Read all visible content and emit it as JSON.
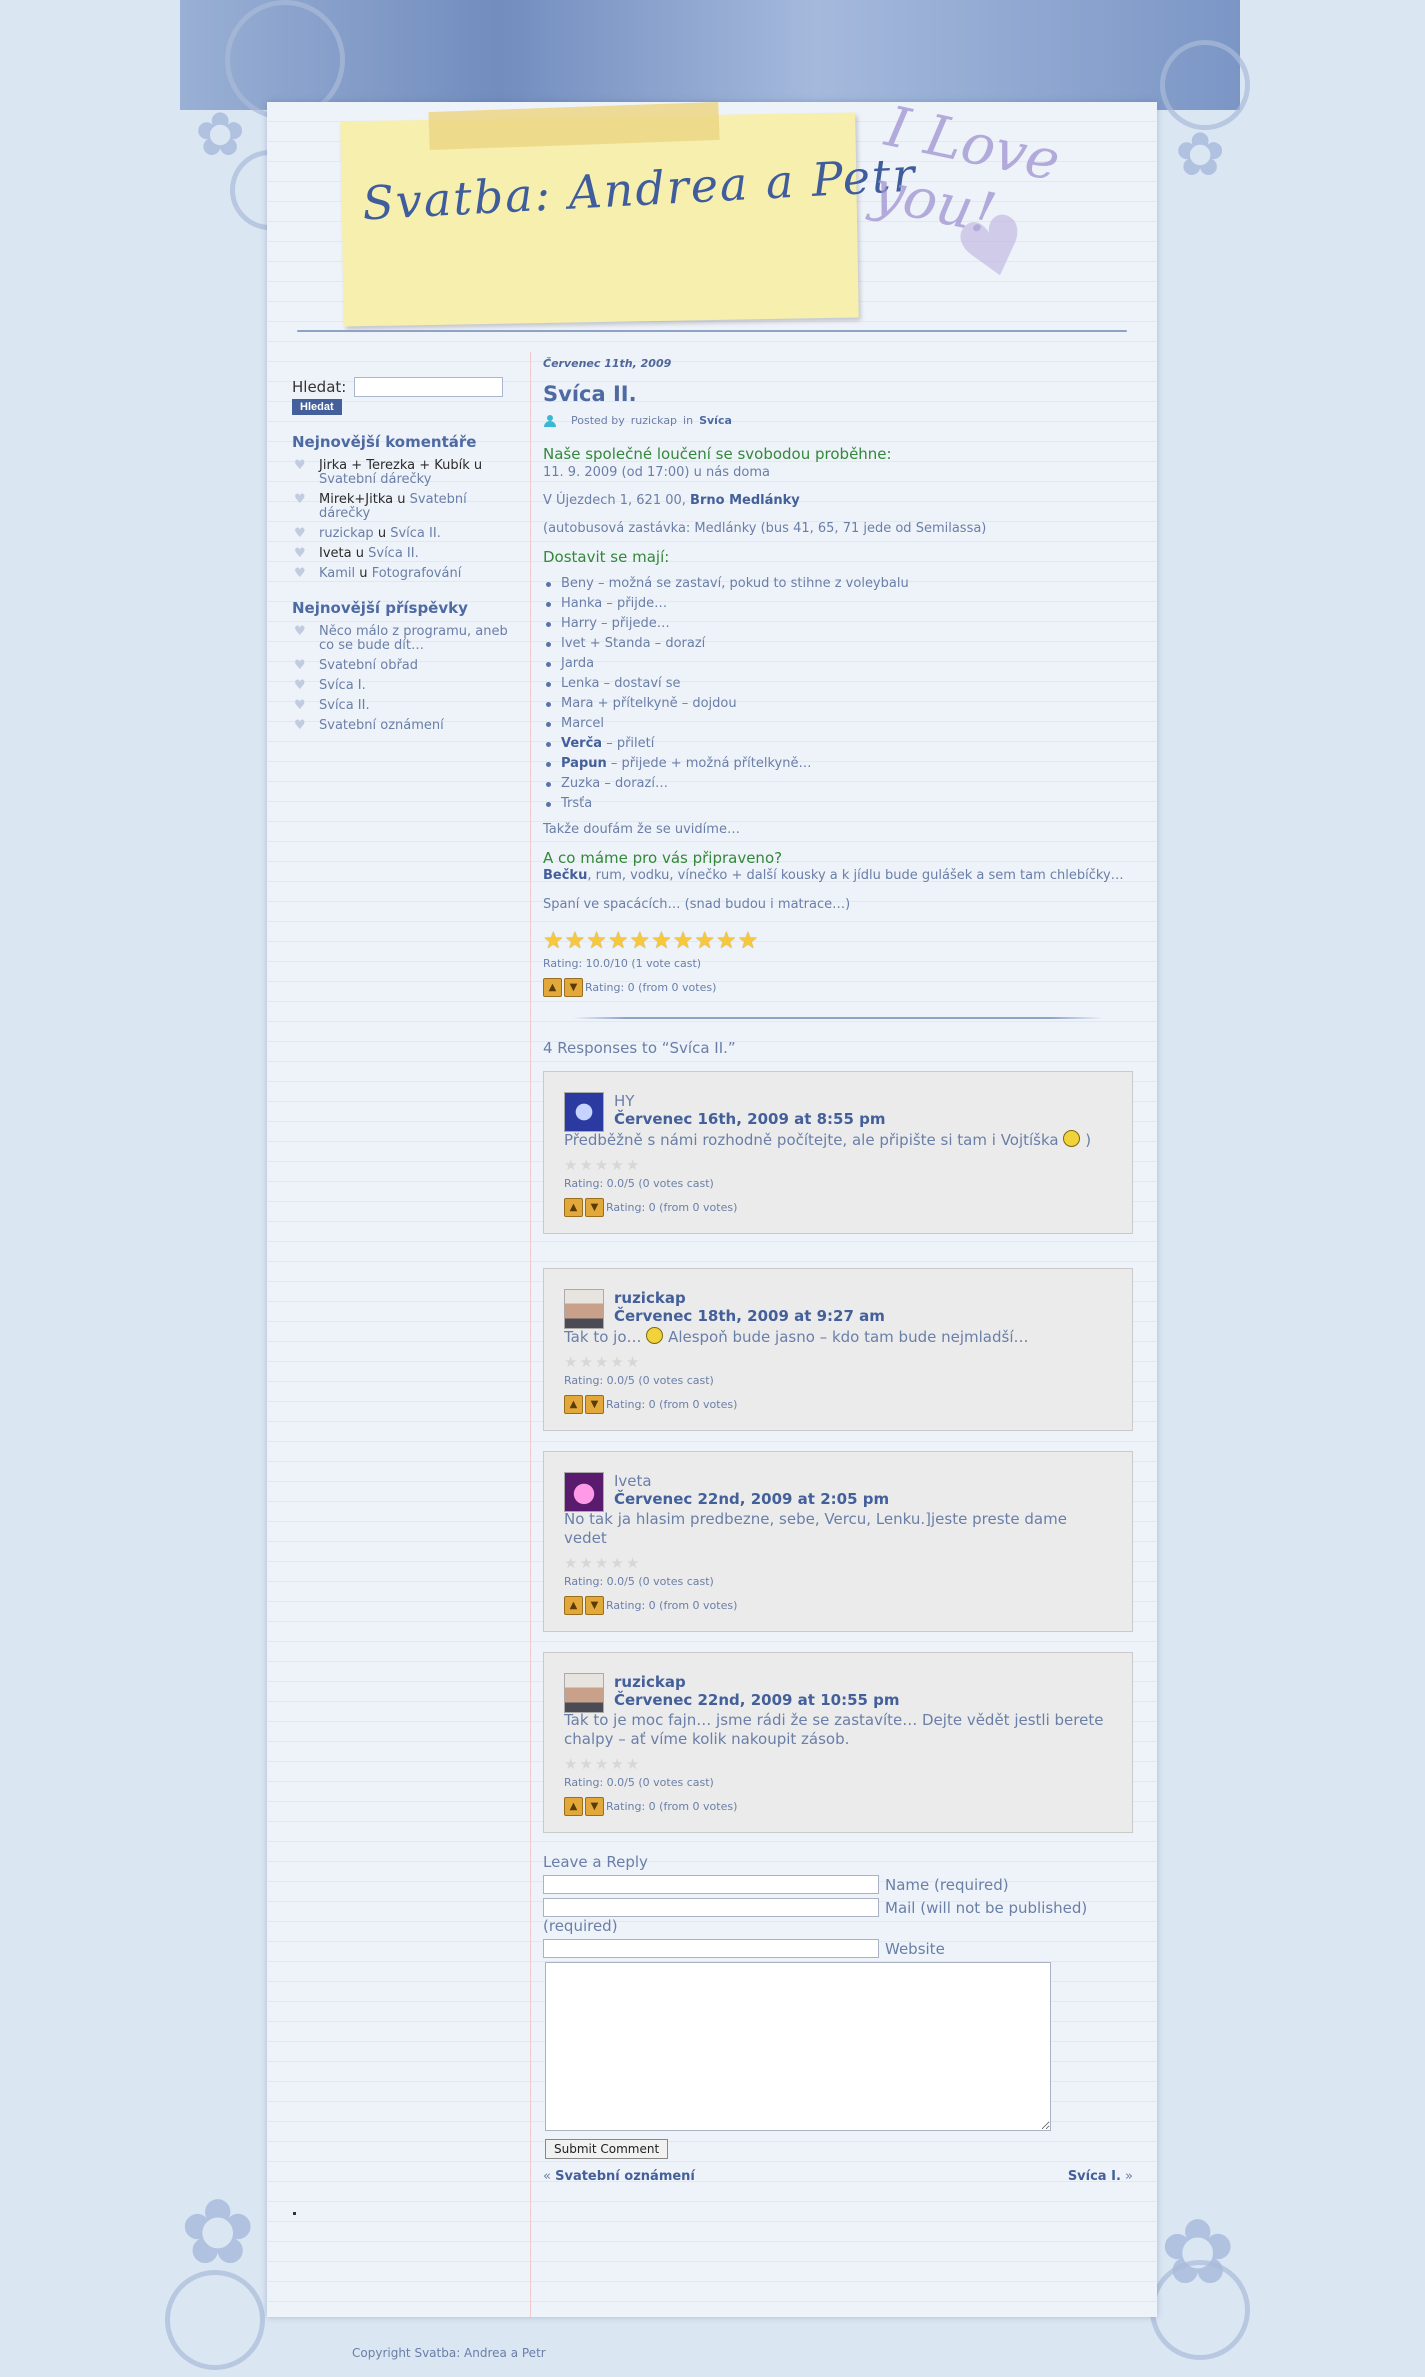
{
  "header": {
    "site_title": "Svatba: Andrea a Petr",
    "decor_text": "I Love you!"
  },
  "sidebar": {
    "search": {
      "label": "Hledat:",
      "button": "Hledat"
    },
    "recent_comments_title": "Nejnovější komentáře",
    "recent_comments": [
      {
        "author": "Jirka + Terezka + Kubík",
        "sep": "u",
        "post": "Svatební dárečky"
      },
      {
        "author": "Mirek+Jitka",
        "sep": "u",
        "post": "Svatební dárečky"
      },
      {
        "author": "ruzickap",
        "sep": "u",
        "post": "Svíca II."
      },
      {
        "author": "Iveta",
        "sep": "u",
        "post": "Svíca II."
      },
      {
        "author": "Kamil",
        "sep": "u",
        "post": "Fotografování"
      }
    ],
    "recent_posts_title": "Nejnovější příspěvky",
    "recent_posts": [
      "Něco málo z programu, aneb co se bude dít…",
      "Svatební obřad",
      "Svíca I.",
      "Svíca II.",
      "Svatební oznámení"
    ]
  },
  "post": {
    "date": "Červenec 11th, 2009",
    "title": "Svíca II.",
    "meta_prefix": "Posted by",
    "meta_author": "ruzickap",
    "meta_in": "in",
    "meta_category": "Svíca",
    "heading1": "Naše společné loučení se svobodou proběhne:",
    "line_date": "11. 9. 2009 (od 17:00) u nás doma",
    "line_addr_prefix": "V Újezdech 1, 621 00,",
    "line_addr_bold": "Brno Medlánky",
    "line_bus": "(autobusová zastávka: Medlánky (bus 41, 65, 71 jede od Semilassa)",
    "heading2": "Dostavit se mají:",
    "guests": [
      {
        "bold": "",
        "text": "Beny – možná se zastaví, pokud to stihne z voleybalu"
      },
      {
        "bold": "",
        "text": "Hanka – přijde…"
      },
      {
        "bold": "",
        "text": "Harry – přijede…"
      },
      {
        "bold": "",
        "text": "Ivet + Standa – dorazí"
      },
      {
        "bold": "",
        "text": "Jarda"
      },
      {
        "bold": "",
        "text": "Lenka – dostaví se"
      },
      {
        "bold": "",
        "text": "Mara + přítelkyně – dojdou"
      },
      {
        "bold": "",
        "text": "Marcel"
      },
      {
        "bold": "Verča",
        "text": " – přiletí"
      },
      {
        "bold": "Papun",
        "text": " – přijede + možná přítelkyně…"
      },
      {
        "bold": "",
        "text": "Zuzka – dorazí…"
      },
      {
        "bold": "",
        "text": "Trsťa"
      }
    ],
    "closing": "Takže doufám že se uvidíme…",
    "heading3": "A co máme pro vás připraveno?",
    "menu_bold": "Bečku",
    "menu_text": ", rum, vodku, vínečko + další kousky a k jídlu bude gulášek a sem tam chlebíčky…",
    "sleep": "Spaní ve spacácích… (snad budou i matrace…)",
    "rating": {
      "stars": 10,
      "max": 10,
      "text": "Rating: 10.0/10 (1 vote cast)"
    },
    "thumbs_text": "Rating: 0 (from 0 votes)"
  },
  "comments": {
    "title": "4 Responses to “Svíca II.”",
    "items": [
      {
        "author": "HY",
        "date": "Červenec 16th, 2009 at 8:55 pm",
        "text_before": "Předběžně s námi rozhodně počítejte, ale připište si tam i Vojtíška",
        "text_after": ")",
        "rating": "Rating: 0.0/5 (0 votes cast)",
        "thumbs": "Rating: 0 (from 0 votes)"
      },
      {
        "author": "ruzickap",
        "date": "Červenec 18th, 2009 at 9:27 am",
        "text_before": "Tak to jo…",
        "text_after": "Alespoň bude jasno – kdo tam bude nejmladší…",
        "rating": "Rating: 0.0/5 (0 votes cast)",
        "thumbs": "Rating: 0 (from 0 votes)"
      },
      {
        "author": "Iveta",
        "date": "Červenec 22nd, 2009 at 2:05 pm",
        "text": "No tak ja hlasim predbezne, sebe, Vercu, Lenku.]jeste preste dame vedet",
        "rating": "Rating: 0.0/5 (0 votes cast)",
        "thumbs": "Rating: 0 (from 0 votes)"
      },
      {
        "author": "ruzickap",
        "date": "Červenec 22nd, 2009 at 10:55 pm",
        "text": "Tak to je moc fajn… jsme rádi že se zastavíte… Dejte vědět jestli berete chalpy – ať víme kolik nakoupit zásob.",
        "rating": "Rating: 0.0/5 (0 votes cast)",
        "thumbs": "Rating: 0 (from 0 votes)"
      }
    ]
  },
  "reply_form": {
    "title": "Leave a Reply",
    "name_label": "Name (required)",
    "mail_label": "Mail (will not be published)",
    "mail_required": "(required)",
    "website_label": "Website",
    "submit": "Submit Comment"
  },
  "post_nav": {
    "prev_arrow": "«",
    "prev": "Svatební oznámení",
    "next": "Svíca I.",
    "next_arrow": "»"
  },
  "footer": {
    "copyright": "Copyright Svatba: Andrea a Petr"
  }
}
